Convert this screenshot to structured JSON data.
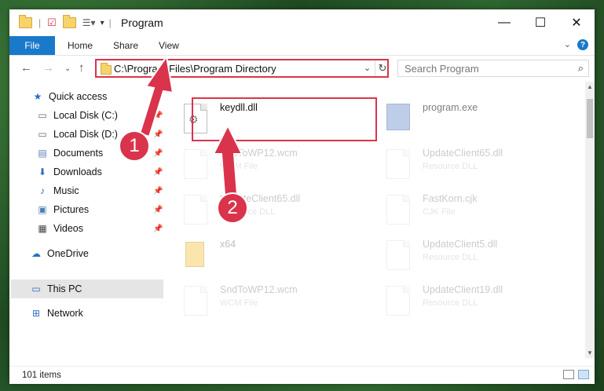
{
  "window": {
    "title": "Program",
    "controls": {
      "minimize": "—",
      "maximize": "☐",
      "close": "✕"
    }
  },
  "ribbon": {
    "file": "File",
    "tabs": [
      "Home",
      "Share",
      "View"
    ],
    "help": "?"
  },
  "address": {
    "path": "C:\\Program Files\\Program Directory"
  },
  "search": {
    "placeholder": "Search Program"
  },
  "sidebar": {
    "quick_access": "Quick access",
    "items": [
      {
        "label": "Local Disk (C:)",
        "icon": "drive-icon"
      },
      {
        "label": "Local Disk (D:)",
        "icon": "drive-icon"
      },
      {
        "label": "Documents",
        "icon": "documents-icon"
      },
      {
        "label": "Downloads",
        "icon": "downloads-icon"
      },
      {
        "label": "Music",
        "icon": "music-icon"
      },
      {
        "label": "Pictures",
        "icon": "pictures-icon"
      },
      {
        "label": "Videos",
        "icon": "videos-icon"
      }
    ],
    "onedrive": "OneDrive",
    "this_pc": "This PC",
    "network": "Network"
  },
  "files": [
    {
      "name": "keydll.dll",
      "type": ""
    },
    {
      "name": "program.exe",
      "type": ""
    },
    {
      "name": "SndToWP12.wcm",
      "type": "WCM File"
    },
    {
      "name": "UpdateClient65.dll",
      "type": "Resource DLL"
    },
    {
      "name": "UpdateClient65.dll",
      "type": "Resource DLL"
    },
    {
      "name": "FastKorn.cjk",
      "type": "CJK File"
    },
    {
      "name": "x64",
      "type": ""
    },
    {
      "name": "UpdateClient5.dll",
      "type": "Resource DLL"
    },
    {
      "name": "SndToWP12.wcm",
      "type": "WCM File"
    },
    {
      "name": "UpdateClient19.dll",
      "type": "Resource DLL"
    }
  ],
  "status": {
    "item_count": "101 items"
  },
  "annotations": {
    "step1": "1",
    "step2": "2",
    "color": "#d9344b"
  }
}
